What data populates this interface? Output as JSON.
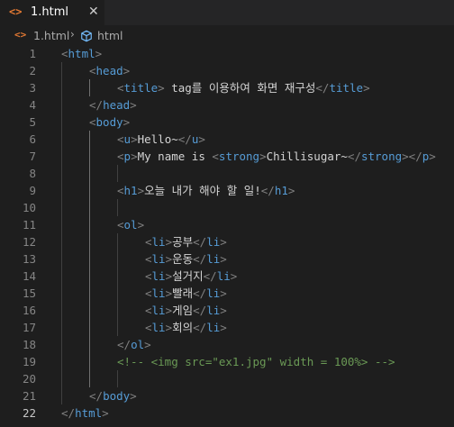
{
  "tab": {
    "icon": "html-file-icon",
    "filename": "1.html",
    "close": "✕"
  },
  "breadcrumb": {
    "file": "1.html",
    "separator": "›",
    "element_icon": "cube-icon",
    "element": "html"
  },
  "active_line": 22,
  "lines": [
    {
      "n": "1",
      "indent": 0,
      "tokens": [
        [
          "tg",
          "<"
        ],
        [
          "tn",
          "html"
        ],
        [
          "tg",
          ">"
        ]
      ]
    },
    {
      "n": "2",
      "indent": 1,
      "tokens": [
        [
          "tg",
          "<"
        ],
        [
          "tn",
          "head"
        ],
        [
          "tg",
          ">"
        ]
      ]
    },
    {
      "n": "3",
      "indent": 2,
      "tokens": [
        [
          "tg",
          "<"
        ],
        [
          "tn",
          "title"
        ],
        [
          "tg",
          ">"
        ],
        [
          "tx",
          " tag를 이용하여 화면 재구성"
        ],
        [
          "tg",
          "</"
        ],
        [
          "tn",
          "title"
        ],
        [
          "tg",
          ">"
        ]
      ]
    },
    {
      "n": "4",
      "indent": 1,
      "tokens": [
        [
          "tg",
          "</"
        ],
        [
          "tn",
          "head"
        ],
        [
          "tg",
          ">"
        ]
      ]
    },
    {
      "n": "5",
      "indent": 1,
      "tokens": [
        [
          "tg",
          "<"
        ],
        [
          "tn",
          "body"
        ],
        [
          "tg",
          ">"
        ]
      ]
    },
    {
      "n": "6",
      "indent": 2,
      "tokens": [
        [
          "tg",
          "<"
        ],
        [
          "tn",
          "u"
        ],
        [
          "tg",
          ">"
        ],
        [
          "tx",
          "Hello~"
        ],
        [
          "tg",
          "</"
        ],
        [
          "tn",
          "u"
        ],
        [
          "tg",
          ">"
        ]
      ]
    },
    {
      "n": "7",
      "indent": 2,
      "tokens": [
        [
          "tg",
          "<"
        ],
        [
          "tn",
          "p"
        ],
        [
          "tg",
          ">"
        ],
        [
          "tx",
          "My name is "
        ],
        [
          "tg",
          "<"
        ],
        [
          "tn",
          "strong"
        ],
        [
          "tg",
          ">"
        ],
        [
          "tx",
          "Chillisugar~"
        ],
        [
          "tg",
          "</"
        ],
        [
          "tn",
          "strong"
        ],
        [
          "tg",
          "></"
        ],
        [
          "tn",
          "p"
        ],
        [
          "tg",
          ">"
        ]
      ]
    },
    {
      "n": "8",
      "indent": 2,
      "tokens": []
    },
    {
      "n": "9",
      "indent": 2,
      "tokens": [
        [
          "tg",
          "<"
        ],
        [
          "tn",
          "h1"
        ],
        [
          "tg",
          ">"
        ],
        [
          "tx",
          "오늘 내가 해야 할 일!"
        ],
        [
          "tg",
          "</"
        ],
        [
          "tn",
          "h1"
        ],
        [
          "tg",
          ">"
        ]
      ]
    },
    {
      "n": "10",
      "indent": 2,
      "tokens": []
    },
    {
      "n": "11",
      "indent": 2,
      "tokens": [
        [
          "tg",
          "<"
        ],
        [
          "tn",
          "ol"
        ],
        [
          "tg",
          ">"
        ]
      ]
    },
    {
      "n": "12",
      "indent": 3,
      "tokens": [
        [
          "tg",
          "<"
        ],
        [
          "tn",
          "li"
        ],
        [
          "tg",
          ">"
        ],
        [
          "tx",
          "공부"
        ],
        [
          "tg",
          "</"
        ],
        [
          "tn",
          "li"
        ],
        [
          "tg",
          ">"
        ]
      ]
    },
    {
      "n": "13",
      "indent": 3,
      "tokens": [
        [
          "tg",
          "<"
        ],
        [
          "tn",
          "li"
        ],
        [
          "tg",
          ">"
        ],
        [
          "tx",
          "운동"
        ],
        [
          "tg",
          "</"
        ],
        [
          "tn",
          "li"
        ],
        [
          "tg",
          ">"
        ]
      ]
    },
    {
      "n": "14",
      "indent": 3,
      "tokens": [
        [
          "tg",
          "<"
        ],
        [
          "tn",
          "li"
        ],
        [
          "tg",
          ">"
        ],
        [
          "tx",
          "설거지"
        ],
        [
          "tg",
          "</"
        ],
        [
          "tn",
          "li"
        ],
        [
          "tg",
          ">"
        ]
      ]
    },
    {
      "n": "15",
      "indent": 3,
      "tokens": [
        [
          "tg",
          "<"
        ],
        [
          "tn",
          "li"
        ],
        [
          "tg",
          ">"
        ],
        [
          "tx",
          "빨래"
        ],
        [
          "tg",
          "</"
        ],
        [
          "tn",
          "li"
        ],
        [
          "tg",
          ">"
        ]
      ]
    },
    {
      "n": "16",
      "indent": 3,
      "tokens": [
        [
          "tg",
          "<"
        ],
        [
          "tn",
          "li"
        ],
        [
          "tg",
          ">"
        ],
        [
          "tx",
          "게임"
        ],
        [
          "tg",
          "</"
        ],
        [
          "tn",
          "li"
        ],
        [
          "tg",
          ">"
        ]
      ]
    },
    {
      "n": "17",
      "indent": 3,
      "tokens": [
        [
          "tg",
          "<"
        ],
        [
          "tn",
          "li"
        ],
        [
          "tg",
          ">"
        ],
        [
          "tx",
          "회의"
        ],
        [
          "tg",
          "</"
        ],
        [
          "tn",
          "li"
        ],
        [
          "tg",
          ">"
        ]
      ]
    },
    {
      "n": "18",
      "indent": 2,
      "tokens": [
        [
          "tg",
          "</"
        ],
        [
          "tn",
          "ol"
        ],
        [
          "tg",
          ">"
        ]
      ]
    },
    {
      "n": "19",
      "indent": 2,
      "tokens": [
        [
          "cm",
          "<!-- <img src=\"ex1.jpg\" width = 100%> -->"
        ]
      ]
    },
    {
      "n": "20",
      "indent": 2,
      "tokens": []
    },
    {
      "n": "21",
      "indent": 1,
      "tokens": [
        [
          "tg",
          "</"
        ],
        [
          "tn",
          "body"
        ],
        [
          "tg",
          ">"
        ]
      ]
    },
    {
      "n": "22",
      "indent": 0,
      "tokens": [
        [
          "tg",
          "</"
        ],
        [
          "tn",
          "html"
        ],
        [
          "tg",
          ">"
        ]
      ]
    }
  ]
}
